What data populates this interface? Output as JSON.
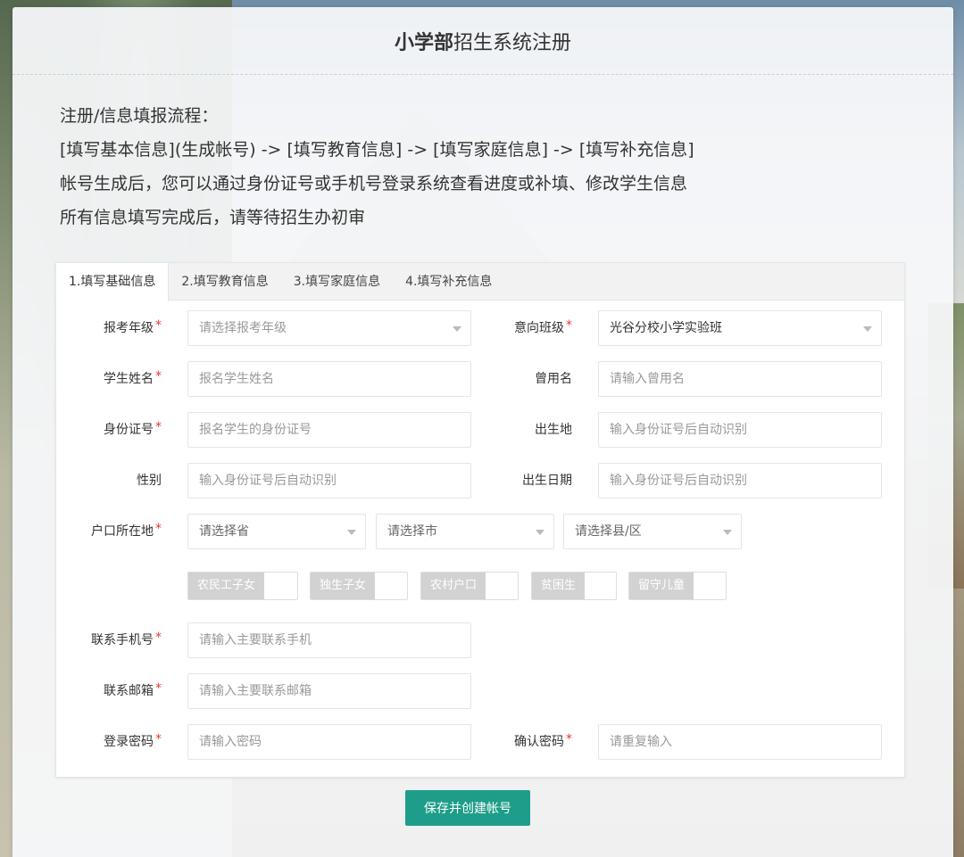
{
  "header": {
    "title_bold": "小学部",
    "title_rest": "招生系统注册"
  },
  "intro": {
    "lines": [
      "注册/信息填报流程：",
      "[填写基本信息](生成帐号) -> [填写教育信息] -> [填写家庭信息] -> [填写补充信息]",
      "帐号生成后，您可以通过身份证号或手机号登录系统查看进度或补填、修改学生信息",
      "所有信息填写完成后，请等待招生办初审"
    ]
  },
  "tabs": [
    {
      "label": "1.填写基础信息",
      "active": true
    },
    {
      "label": "2.填写教育信息",
      "active": false
    },
    {
      "label": "3.填写家庭信息",
      "active": false
    },
    {
      "label": "4.填写补充信息",
      "active": false
    }
  ],
  "form": {
    "grade": {
      "label": "报考年级",
      "placeholder": "请选择报考年级"
    },
    "intended_class": {
      "label": "意向班级",
      "value": "光谷分校小学实验班"
    },
    "student_name": {
      "label": "学生姓名",
      "placeholder": "报名学生姓名"
    },
    "former_name": {
      "label": "曾用名",
      "placeholder": "请输入曾用名"
    },
    "id_number": {
      "label": "身份证号",
      "placeholder": "报名学生的身份证号"
    },
    "birthplace": {
      "label": "出生地",
      "placeholder": "输入身份证号后自动识别"
    },
    "gender": {
      "label": "性别",
      "placeholder": "输入身份证号后自动识别"
    },
    "birth_date": {
      "label": "出生日期",
      "placeholder": "输入身份证号后自动识别"
    },
    "household": {
      "label": "户口所在地",
      "province": "请选择省",
      "city": "请选择市",
      "county": "请选择县/区"
    },
    "flags": [
      "农民工子女",
      "独生子女",
      "农村户口",
      "贫困生",
      "留守儿童"
    ],
    "phone": {
      "label": "联系手机号",
      "placeholder": "请输入主要联系手机"
    },
    "email": {
      "label": "联系邮箱",
      "placeholder": "请输入主要联系邮箱"
    },
    "password": {
      "label": "登录密码",
      "placeholder": "请输入密码"
    },
    "confirm_password": {
      "label": "确认密码",
      "placeholder": "请重复输入"
    },
    "required_mark": "*"
  },
  "actions": {
    "save_label": "保存并创建帐号"
  },
  "colors": {
    "primary": "#1e9e8a",
    "required": "#e53935"
  }
}
